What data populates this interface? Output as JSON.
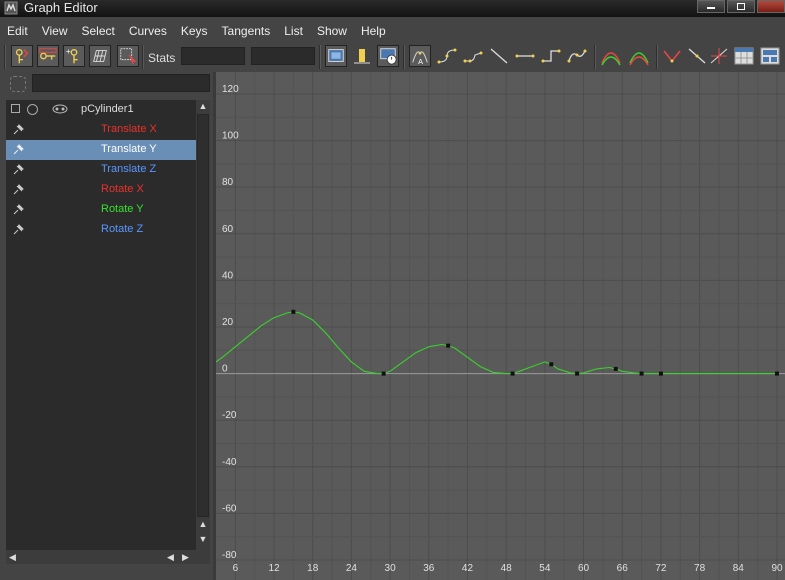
{
  "window": {
    "title": "Graph Editor"
  },
  "menu": [
    "Edit",
    "View",
    "Select",
    "Curves",
    "Keys",
    "Tangents",
    "List",
    "Show",
    "Help"
  ],
  "toolbar": {
    "stats_label": "Stats",
    "stats_field_1": "",
    "stats_field_2": "",
    "buttons": [
      "move-nearest-picked-key-tool",
      "insert-keys-tool",
      "add-keys-tool",
      "lattice-deform-keys-tool",
      "region-select-tool",
      "frame-all",
      "frame-playback-range",
      "center-current-time",
      "auto-tangent",
      "spline-tangent",
      "clamped-tangent",
      "linear-tangent",
      "flat-tangent",
      "step-tangent",
      "plateau-tangent",
      "buffer-curve-snapshot",
      "swap-buffer-curves",
      "break-tangents",
      "unify-tangents",
      "free-tangent-weight",
      "lock-tangent-weight",
      "dope-sheet",
      "trax-editor"
    ]
  },
  "outliner": {
    "filter_value": "",
    "object": {
      "name": "pCylinder1"
    },
    "channels": [
      {
        "label": "Translate X",
        "color": "#e8322c",
        "selected": false
      },
      {
        "label": "Translate Y",
        "color": "#ffffff",
        "selected": true
      },
      {
        "label": "Translate Z",
        "color": "#5a96ff",
        "selected": false
      },
      {
        "label": "Rotate X",
        "color": "#e8322c",
        "selected": false
      },
      {
        "label": "Rotate Y",
        "color": "#36e12e",
        "selected": false
      },
      {
        "label": "Rotate Z",
        "color": "#5a96ff",
        "selected": false
      }
    ]
  },
  "colors": {
    "curve": "#3ad12c",
    "key": "#111111",
    "selection": "#6a8fb6",
    "graph_bg": "#5a5a5a"
  },
  "chart_data": {
    "type": "line",
    "title": "",
    "xlabel": "",
    "ylabel": "",
    "xlim": [
      3,
      90
    ],
    "ylim": [
      -80,
      126
    ],
    "x_ticks": [
      6,
      12,
      18,
      24,
      30,
      36,
      42,
      48,
      54,
      60,
      66,
      72,
      78,
      84,
      90
    ],
    "y_ticks": [
      120,
      100,
      80,
      60,
      40,
      20,
      0,
      -20,
      -40,
      -60,
      -80
    ],
    "grid": true,
    "series": [
      {
        "curve": {
          "x": [
            3,
            4,
            6,
            8,
            10,
            12,
            14,
            15,
            16,
            18,
            20,
            22,
            24,
            26,
            28,
            29,
            30,
            32,
            34,
            36,
            38,
            39,
            40,
            42,
            44,
            46,
            48,
            49,
            50,
            52,
            54,
            55,
            56,
            58,
            59,
            60,
            62,
            64,
            65,
            66,
            68,
            69,
            70,
            72,
            90
          ],
          "y": [
            5,
            7,
            11.5,
            16,
            20.5,
            24,
            26,
            26.5,
            26,
            23,
            17.5,
            11,
            5,
            1,
            0,
            0,
            1,
            5,
            9,
            11.5,
            12.5,
            12,
            11,
            7,
            3,
            0.5,
            0,
            0,
            1,
            3,
            5,
            4,
            2,
            0.3,
            0,
            0.3,
            2,
            2.6,
            2,
            1,
            0.2,
            0,
            0,
            0,
            0
          ]
        },
        "keys": {
          "x": [
            15,
            29,
            39,
            49,
            55,
            59,
            65,
            69,
            72,
            90
          ],
          "y": [
            26.5,
            0,
            12,
            0,
            4,
            0,
            2,
            0,
            0,
            0
          ]
        }
      }
    ]
  }
}
